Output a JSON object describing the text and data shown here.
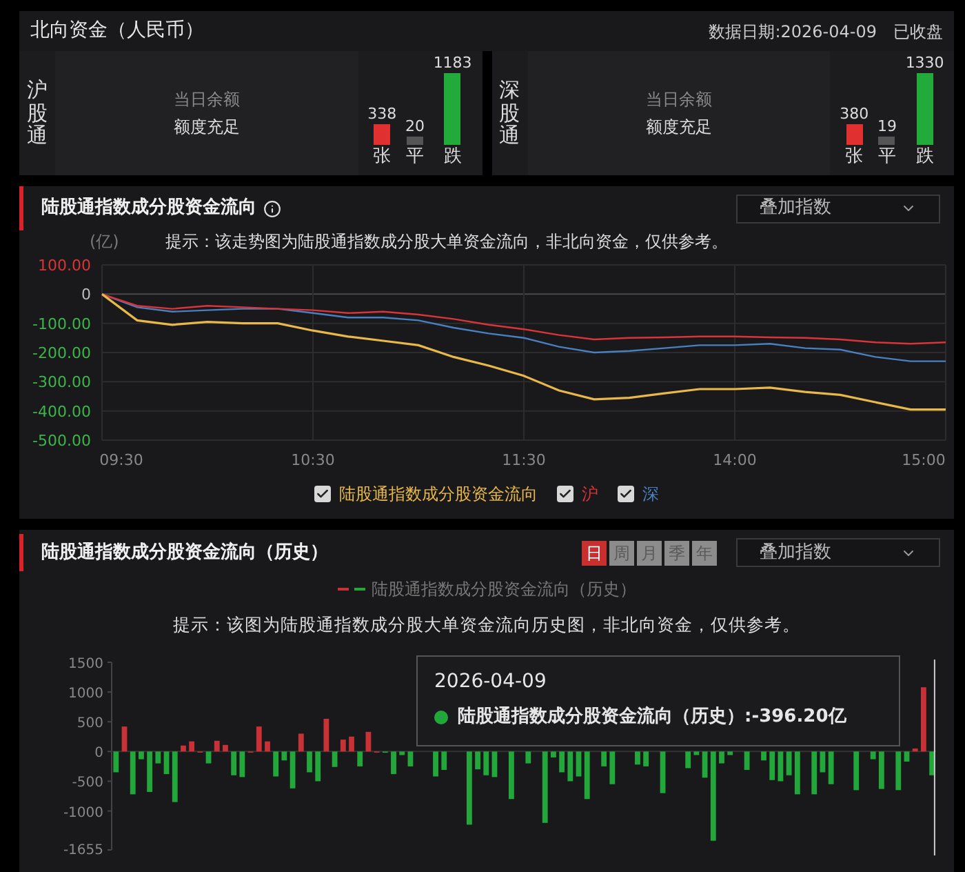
{
  "northbound": {
    "title": "北向资金（人民币）",
    "date_label": "数据日期:2026-04-09",
    "status": "已收盘",
    "channels": [
      {
        "name": "沪股通",
        "balance_label": "当日余额",
        "balance_value": "额度充足",
        "stats": [
          {
            "kind": "up",
            "count": "338",
            "label": "张"
          },
          {
            "kind": "flat",
            "count": "20",
            "label": "平"
          },
          {
            "kind": "down",
            "count": "1183",
            "label": "跌"
          }
        ]
      },
      {
        "name": "深股通",
        "balance_label": "当日余额",
        "balance_value": "额度充足",
        "stats": [
          {
            "kind": "up",
            "count": "380",
            "label": "张"
          },
          {
            "kind": "flat",
            "count": "19",
            "label": "平"
          },
          {
            "kind": "down",
            "count": "1330",
            "label": "跌"
          }
        ]
      }
    ]
  },
  "intraday": {
    "title": "陆股通指数成分股资金流向",
    "dropdown": "叠加指数",
    "unit": "(亿)",
    "hint": "提示：该走势图为陆股通指数成分股大单资金流向，非北向资金，仅供参考。",
    "chart_data": {
      "type": "line",
      "categories": [
        "09:30",
        null,
        null,
        null,
        null,
        null,
        "10:30",
        null,
        null,
        null,
        null,
        null,
        "11:30",
        null,
        null,
        null,
        null,
        null,
        "14:00",
        null,
        null,
        null,
        null,
        null,
        "15:00"
      ],
      "ylim": [
        -500,
        100
      ],
      "grid": true,
      "yticks": [
        {
          "value": 100,
          "label": "100.00"
        },
        {
          "value": 0,
          "label": "0"
        },
        {
          "value": -100,
          "label": "-100.00"
        },
        {
          "value": -200,
          "label": "-200.00"
        },
        {
          "value": -300,
          "label": "-300.00"
        },
        {
          "value": -400,
          "label": "-400.00"
        },
        {
          "value": -500,
          "label": "-500.00"
        }
      ],
      "series": [
        {
          "name": "陆股通指数成分股资金流向",
          "color": "#e8b84a",
          "values": [
            0,
            -90,
            -105,
            -95,
            -100,
            -100,
            -125,
            -145,
            -160,
            -175,
            -215,
            -245,
            -280,
            -330,
            -360,
            -355,
            -340,
            -325,
            -325,
            -320,
            -335,
            -345,
            -370,
            -395,
            -395
          ]
        },
        {
          "name": "沪",
          "color": "#d9343a",
          "values": [
            0,
            -40,
            -50,
            -40,
            -45,
            -50,
            -55,
            -65,
            -60,
            -70,
            -85,
            -105,
            -120,
            -140,
            -155,
            -150,
            -148,
            -145,
            -145,
            -148,
            -150,
            -155,
            -165,
            -170,
            -165
          ]
        },
        {
          "name": "深",
          "color": "#4a7fc0",
          "values": [
            0,
            -45,
            -60,
            -55,
            -50,
            -50,
            -65,
            -80,
            -80,
            -90,
            -115,
            -135,
            -150,
            -180,
            -200,
            -195,
            -185,
            -175,
            -175,
            -170,
            -185,
            -190,
            -215,
            -230,
            -230
          ]
        }
      ]
    },
    "legend": [
      {
        "checked": true
      },
      {
        "checked": true
      },
      {
        "checked": true
      }
    ]
  },
  "history": {
    "title": "陆股通指数成分股资金流向（历史）",
    "periods": [
      {
        "label": "日",
        "selected": true
      },
      {
        "label": "周",
        "selected": false
      },
      {
        "label": "月",
        "selected": false
      },
      {
        "label": "季",
        "selected": false
      },
      {
        "label": "年",
        "selected": false
      }
    ],
    "dropdown": "叠加指数",
    "legend_label": "陆股通指数成分股资金流向（历史）",
    "hint": "提示：该图为陆股通指数成分股大单资金流向历史图，非北向资金，仅供参考。",
    "chart_data": {
      "type": "bar",
      "ylim": [
        -1655,
        1500
      ],
      "yticks": [
        1500,
        1000,
        500,
        0,
        -500,
        -1000,
        -1655
      ],
      "values": [
        -350,
        420,
        -720,
        -130,
        -680,
        -200,
        -380,
        -850,
        100,
        170,
        0,
        -200,
        180,
        110,
        -400,
        -430,
        0,
        420,
        170,
        -420,
        -150,
        -620,
        300,
        -350,
        -500,
        550,
        -260,
        200,
        250,
        -250,
        330,
        0,
        -20,
        -380,
        -60,
        -250,
        null,
        null,
        -420,
        -310,
        null,
        null,
        -1230,
        -300,
        -400,
        -430,
        null,
        -800,
        null,
        -200,
        null,
        -1200,
        -100,
        -350,
        -500,
        -420,
        -800,
        null,
        -250,
        -550,
        null,
        null,
        -220,
        -250,
        null,
        -700,
        null,
        null,
        -280,
        -60,
        -440,
        -1500,
        -200,
        -60,
        null,
        -310,
        null,
        -150,
        -480,
        -500,
        -400,
        -720,
        null,
        -720,
        -350,
        -550,
        null,
        null,
        -650,
        null,
        -130,
        -630,
        null,
        -650,
        -170,
        50,
        1080,
        -400
      ]
    },
    "tooltip": {
      "date": "2026-04-09",
      "text": "陆股通指数成分股资金流向（历史）:-396.20亿"
    }
  }
}
